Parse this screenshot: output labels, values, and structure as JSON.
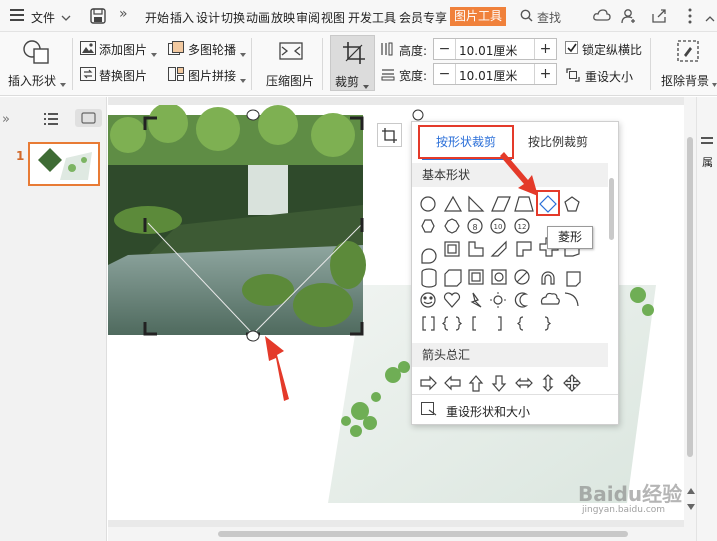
{
  "menubar": {
    "file_label": "文件",
    "tabs": [
      "开始",
      "插入",
      "设计",
      "切换",
      "动画",
      "放映",
      "审阅",
      "视图",
      "开发工具",
      "会员专享"
    ],
    "active_context_tab": "图片工具",
    "search_label": "查找"
  },
  "ribbon": {
    "insert_shape": "插入形状",
    "add_picture": "添加图片",
    "replace_picture": "替换图片",
    "multi_outline": "多图轮播",
    "picture_stitch": "图片拼接",
    "compress": "压缩图片",
    "crop": "裁剪",
    "height_label": "高度:",
    "height_value": "10.01厘米",
    "width_label": "宽度:",
    "width_value": "10.01厘米",
    "lock_ratio": "锁定纵横比",
    "reset_size": "重设大小",
    "remove_bg": "抠除背景",
    "minus": "−",
    "plus": "+"
  },
  "slides_panel": {
    "slide_number": "1"
  },
  "crop_panel": {
    "tab_shape": "按形状裁剪",
    "tab_ratio": "按比例裁剪",
    "section_basic": "基本形状",
    "section_arrows": "箭头总汇",
    "reset_label": "重设形状和大小",
    "tooltip": "菱形"
  },
  "right_panel": {
    "label": "属"
  },
  "watermark": {
    "brand": "Baidu经验",
    "url": "jingyan.baidu.com"
  },
  "colors": {
    "accent_orange": "#f0813b",
    "highlight_red": "#e43a2a",
    "tab_blue": "#2b6fd8"
  }
}
